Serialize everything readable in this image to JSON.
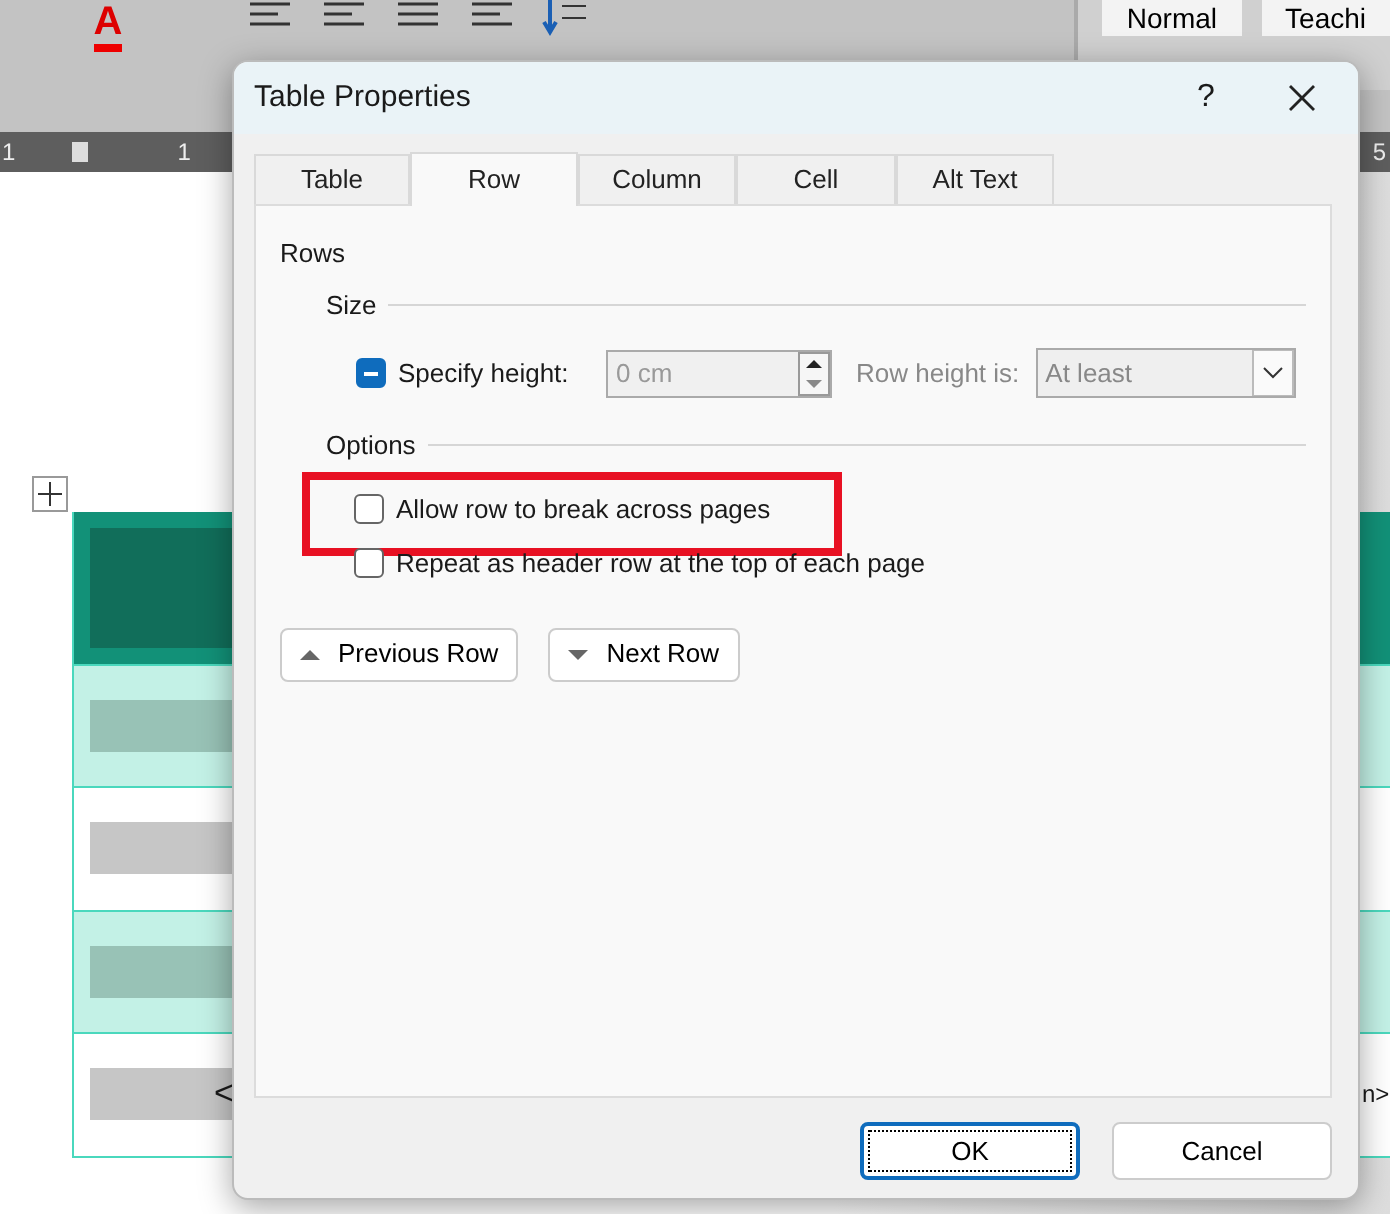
{
  "background": {
    "ribbon": {
      "font_color_glyph": "A",
      "styles": [
        {
          "label": "Normal"
        },
        {
          "label": "Teachi"
        }
      ]
    },
    "ruler": {
      "labels": [
        "1",
        "1",
        "5"
      ]
    },
    "table": {
      "rows": [
        {
          "kind": "header"
        },
        {
          "kind": "band"
        },
        {
          "kind": "plain"
        },
        {
          "kind": "band"
        },
        {
          "kind": "plain",
          "cell_left": "<",
          "cell_right": "n>"
        }
      ]
    }
  },
  "dialog": {
    "title": "Table Properties",
    "help": "?",
    "tabs": [
      {
        "label": "Table",
        "selected": false
      },
      {
        "label": "Row",
        "selected": true
      },
      {
        "label": "Column",
        "selected": false
      },
      {
        "label": "Cell",
        "selected": false
      },
      {
        "label": "Alt Text",
        "selected": false
      }
    ],
    "section": "Rows",
    "size_group": {
      "title": "Size",
      "specify_height": {
        "label": "Specify height:",
        "indeterminate": true
      },
      "height_field": {
        "value": "0 cm",
        "disabled": true
      },
      "row_height_label": "Row height is:",
      "row_height_select": {
        "value": "At least",
        "disabled": true
      }
    },
    "options_group": {
      "title": "Options",
      "checkboxes": [
        {
          "label": "Allow row to break across pages",
          "checked": false,
          "highlighted": true
        },
        {
          "label": "Repeat as header row at the top of each page",
          "checked": false
        }
      ]
    },
    "nav_buttons": [
      {
        "label": "Previous Row",
        "kind": "up"
      },
      {
        "label": "Next Row",
        "kind": "down"
      }
    ],
    "buttons": [
      {
        "label": "OK",
        "default": true
      },
      {
        "label": "Cancel",
        "default": false
      }
    ]
  }
}
